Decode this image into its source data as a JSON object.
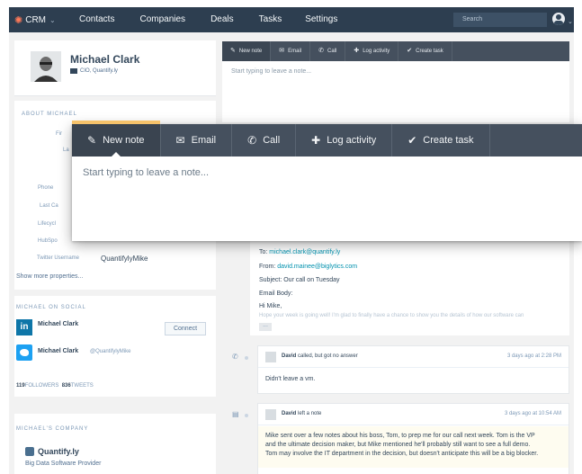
{
  "nav": {
    "brand": "CRM",
    "items": [
      {
        "label": "Contacts",
        "active": true
      },
      {
        "label": "Companies",
        "active": false
      },
      {
        "label": "Deals",
        "active": false
      },
      {
        "label": "Tasks",
        "active": false
      },
      {
        "label": "Settings",
        "active": false
      }
    ],
    "search_placeholder": "Search"
  },
  "profile": {
    "name": "Michael Clark",
    "subtitle": "CIO, Quantify.ly"
  },
  "about": {
    "title": "ABOUT MICHAEL",
    "partial_labels": [
      "Fir",
      "La",
      "Phone",
      "Last Ca",
      "Lifecycl",
      "HubSpo"
    ],
    "twitter_label": "Twitter Username",
    "twitter_value": "QuantifylyMike",
    "show_more": "Show more properties..."
  },
  "social": {
    "title": "MICHAEL ON SOCIAL",
    "linkedin_badge": "in",
    "linkedin_name": "Michael Clark",
    "connect_label": "Connect",
    "twitter_name": "Michael Clark",
    "twitter_handle": "@QuantifylyMike",
    "followers_count": "119",
    "followers_label": "FOLLOWERS",
    "tweets_count": "836",
    "tweets_label": "TWEETS"
  },
  "company": {
    "title": "MICHAEL'S COMPANY",
    "name": "Quantify.ly",
    "description": "Big Data Software Provider"
  },
  "editor_tabs": [
    {
      "label": "New note",
      "icon": "pencil-icon",
      "glyph": "✎"
    },
    {
      "label": "Email",
      "icon": "envelope-icon",
      "glyph": "✉"
    },
    {
      "label": "Call",
      "icon": "phone-icon",
      "glyph": "✆"
    },
    {
      "label": "Log activity",
      "icon": "plus-icon",
      "glyph": "✚"
    },
    {
      "label": "Create task",
      "icon": "check-circle-icon",
      "glyph": "✔"
    }
  ],
  "editor_placeholder": "Start typing to leave a note...",
  "email_activity": {
    "to_label": "To:",
    "to": "michael.clark@quantify.ly",
    "from_label": "From:",
    "from": "david.mainee@biglytics.com",
    "subject": "Subject: Our call on Tuesday",
    "body_label": "Email Body:",
    "greeting": "Hi Mike,",
    "faded": "Hope your week is going well! I'm glad to finally have a chance to show you the details of how our software can",
    "more": "..."
  },
  "timeline": [
    {
      "icon": "phone-icon",
      "glyph": "✆",
      "actor": "David",
      "action": "called, but got no answer",
      "time": "3 days ago at 2:28 PM",
      "body": [
        "Didn't leave a vm."
      ]
    },
    {
      "icon": "note-icon",
      "glyph": "▤",
      "actor": "David",
      "action": "left a note",
      "time": "3 days ago at 10:54 AM",
      "body": [
        "Mike sent over a few notes about his boss, Tom, to prep me for our call next week. Tom is the VP",
        "and the ultimate decision maker, but Mike mentioned he'll probably still want to see a full demo.",
        "Tom may involve the IT department in the decision, but doesn't anticipate this will be a big blocker."
      ]
    }
  ],
  "colors": {
    "nav_bg": "#2d3e50",
    "toolbar_bg": "#45505e",
    "active_accent": "#f5c26b",
    "link": "#0091ae",
    "linkedin": "#0e76a8",
    "twitter": "#1da1f2"
  }
}
